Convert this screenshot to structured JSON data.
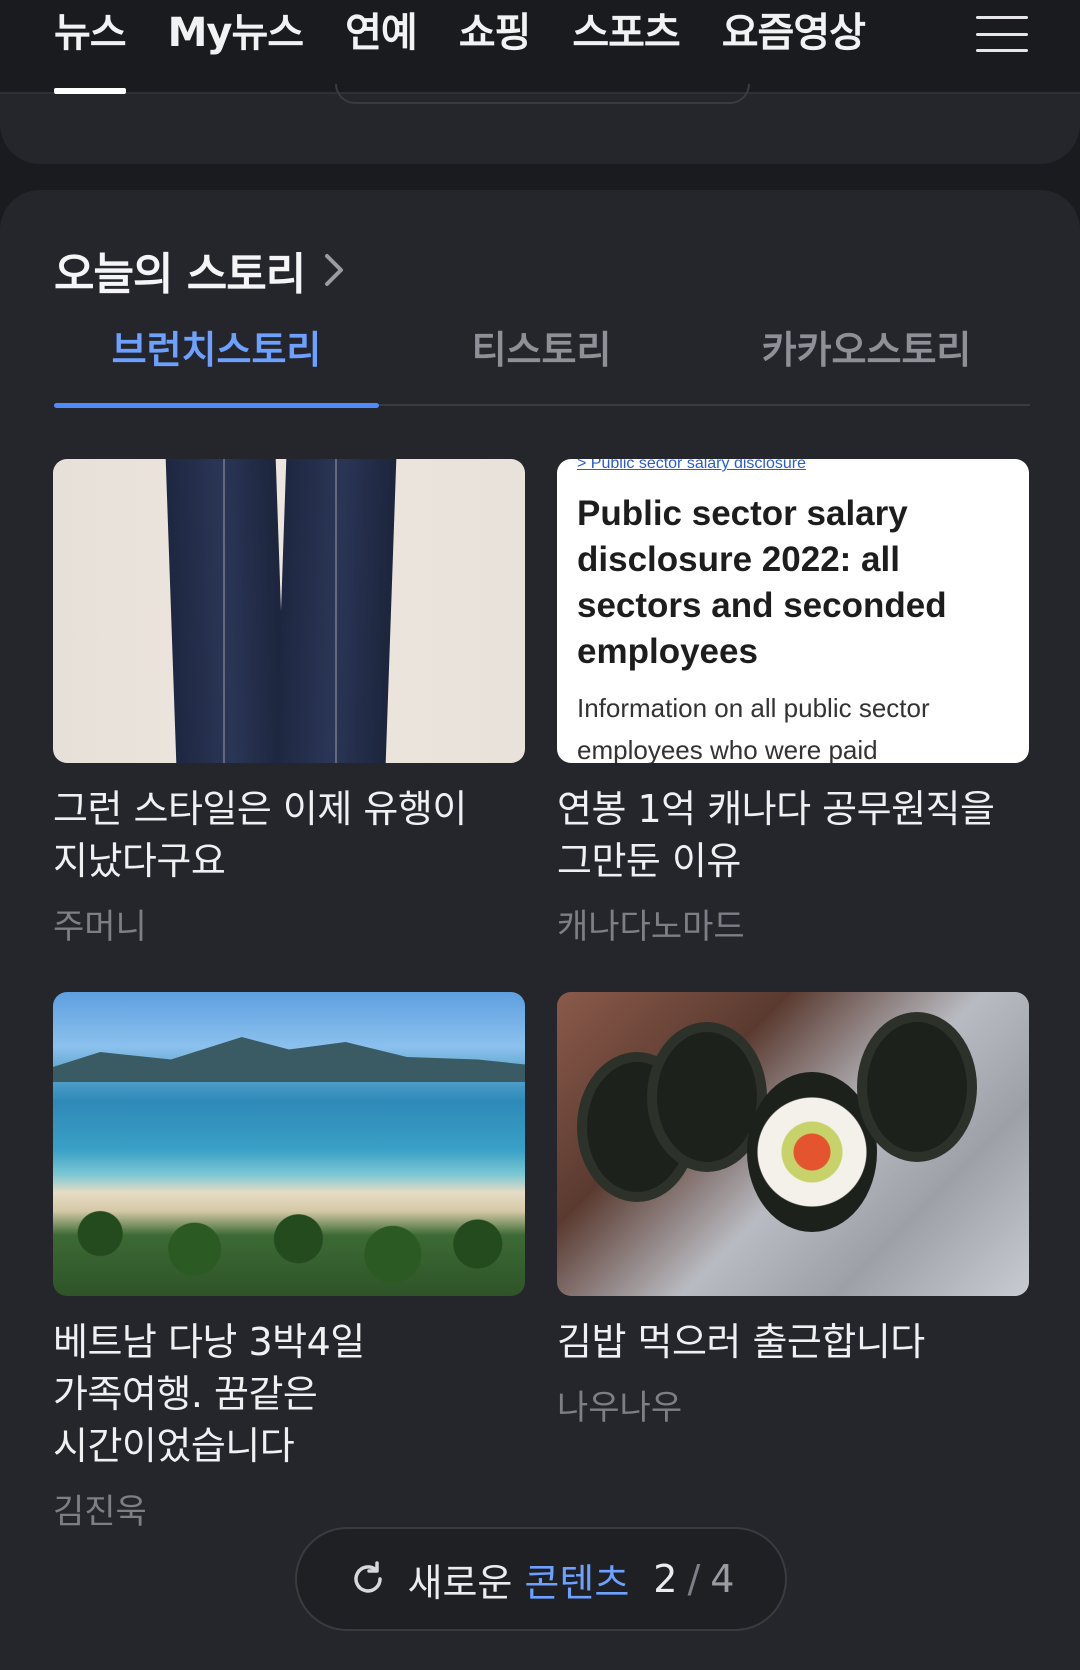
{
  "top_nav": {
    "tabs": [
      "뉴스",
      "My뉴스",
      "연예",
      "쇼핑",
      "스포츠",
      "요즘영상"
    ],
    "active_index": 0
  },
  "section": {
    "title": "오늘의 스토리",
    "subtabs": [
      "브런치스토리",
      "티스토리",
      "카카오스토리"
    ],
    "active_subtab": 0
  },
  "items": [
    {
      "headline": "그런 스타일은 이제 유행이 지났다구요",
      "author": "주머니"
    },
    {
      "headline": "연봉 1억 캐나다 공무원직을 그만둔 이유",
      "author": "캐나다노마드",
      "thumb_doc": {
        "crumb": "> Public sector salary disclosure",
        "title": "Public sector salary disclosure 2022: all sectors and seconded employees",
        "sub": "Information on all public sector employees who were paid"
      }
    },
    {
      "headline": "베트남 다낭 3박4일 가족여행. 꿈같은 시간이었습니다",
      "author": "김진욱"
    },
    {
      "headline": "김밥 먹으러 출근합니다",
      "author": "나우나우"
    }
  ],
  "more": {
    "label": "새로운",
    "highlight": "콘텐츠",
    "current": "2",
    "separator": "/",
    "total": "4"
  },
  "colors": {
    "background": "#1a1b1f",
    "card": "#25262b",
    "accent": "#6ea0ff",
    "muted": "#7d7e86"
  }
}
